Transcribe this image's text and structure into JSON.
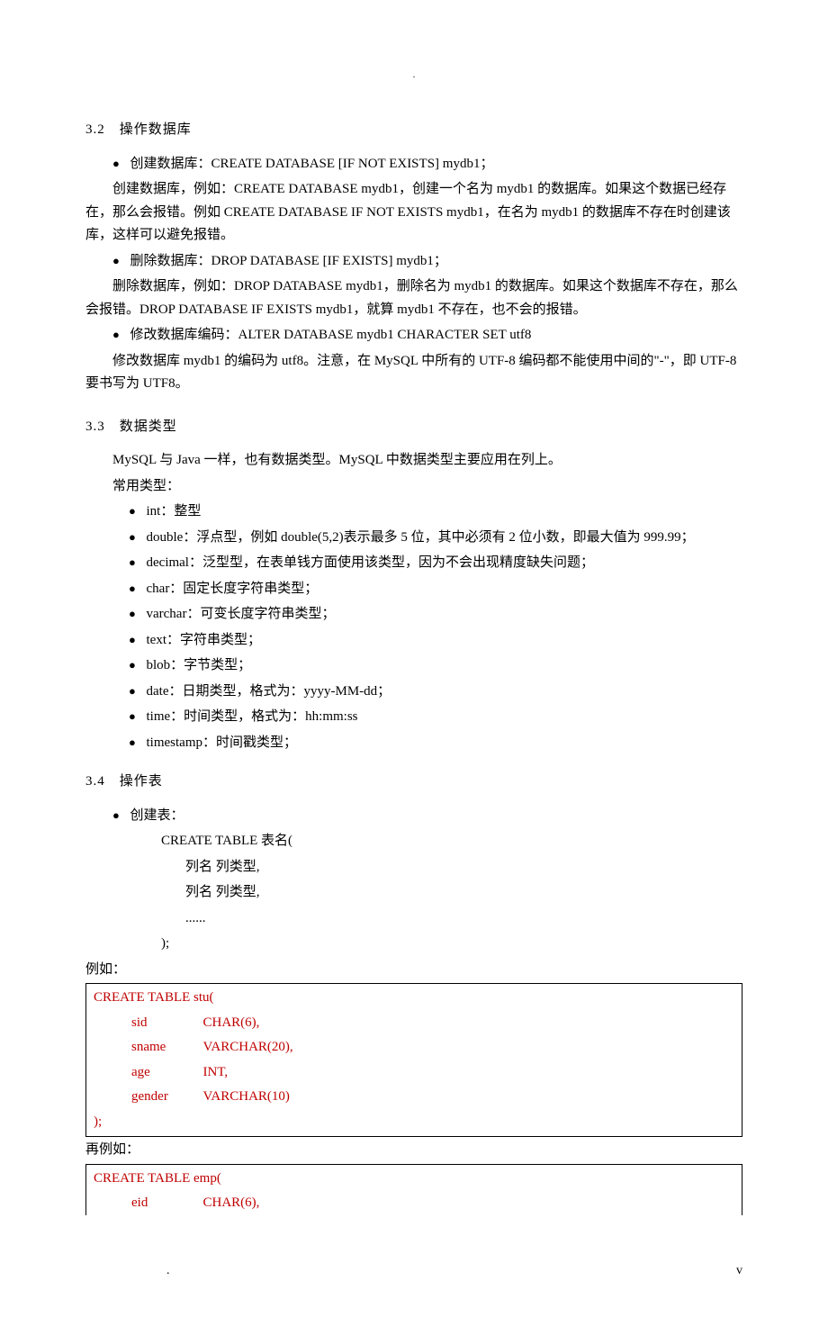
{
  "header_dot": ".",
  "section32": {
    "heading": "3.2　操作数据库",
    "b1": "创建数据库：CREATE DATABASE [IF NOT EXISTS] mydb1；",
    "p1": "创建数据库，例如：CREATE DATABASE mydb1，创建一个名为 mydb1 的数据库。如果这个数据已经存在，那么会报错。例如 CREATE DATABASE IF NOT EXISTS mydb1，在名为 mydb1 的数据库不存在时创建该库，这样可以避免报错。",
    "b2": "删除数据库：DROP DATABASE [IF EXISTS] mydb1；",
    "p2": "删除数据库，例如：DROP DATABASE mydb1，删除名为 mydb1 的数据库。如果这个数据库不存在，那么会报错。DROP DATABASE IF EXISTS mydb1，就算 mydb1 不存在，也不会的报错。",
    "b3": "修改数据库编码：ALTER DATABASE mydb1 CHARACTER SET utf8",
    "p3": "修改数据库 mydb1 的编码为 utf8。注意，在 MySQL 中所有的 UTF-8 编码都不能使用中间的\"-\"，即 UTF-8 要书写为 UTF8。"
  },
  "section33": {
    "heading": "3.3　数据类型",
    "intro": "MySQL 与 Java 一样，也有数据类型。MySQL 中数据类型主要应用在列上。",
    "label": "常用类型：",
    "items": [
      "int：整型",
      "double：浮点型，例如 double(5,2)表示最多 5 位，其中必须有 2 位小数，即最大值为 999.99；",
      "decimal：泛型型，在表单钱方面使用该类型，因为不会出现精度缺失问题；",
      "char：固定长度字符串类型；",
      "varchar：可变长度字符串类型；",
      "text：字符串类型；",
      "blob：字节类型；",
      "date：日期类型，格式为：yyyy-MM-dd；",
      "time：时间类型，格式为：hh:mm:ss",
      "timestamp：时间戳类型；"
    ]
  },
  "section34": {
    "heading": "3.4　操作表",
    "b1": "创建表：",
    "line1": "CREATE TABLE  表名(",
    "line2": "列名  列类型,",
    "line3": "列名  列类型,",
    "line4": "......",
    "line5": ");",
    "example1_label": "例如：",
    "table1": {
      "head": "CREATE TABLE stu(",
      "rows": [
        {
          "c1": "sid",
          "c2": "CHAR(6),"
        },
        {
          "c1": "sname",
          "c2": "VARCHAR(20),"
        },
        {
          "c1": "age",
          "c2": "INT,"
        },
        {
          "c1": "gender",
          "c2": "VARCHAR(10)"
        }
      ],
      "tail": ");"
    },
    "example2_label": "再例如：",
    "table2": {
      "head": "CREATE TABLE emp(",
      "rows": [
        {
          "c1": "eid",
          "c2": "CHAR(6),"
        }
      ]
    }
  },
  "footer": {
    "left": ".",
    "right": "v"
  }
}
